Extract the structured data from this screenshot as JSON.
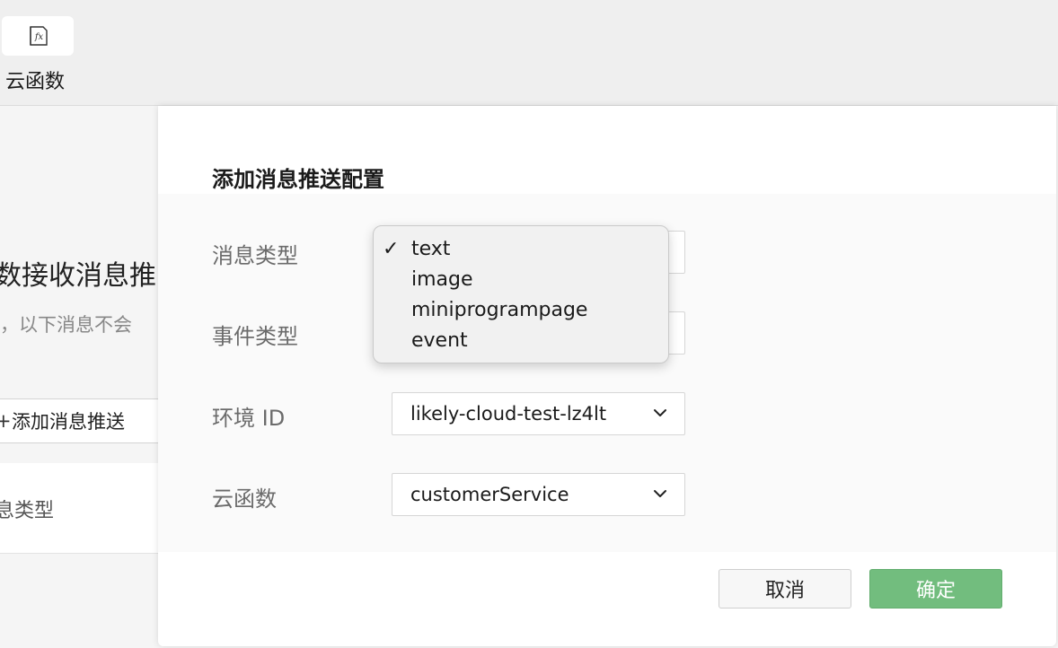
{
  "toolbar": {
    "cloud_function_label": "云函数",
    "cloud_function_icon": "fx-icon"
  },
  "background": {
    "heading": "数接收消息推",
    "subtext": "，以下消息不会",
    "add_button_label": "添加消息推送",
    "table_column": "息类型"
  },
  "dialog": {
    "title": "添加消息推送配置",
    "fields": {
      "message_type_label": "消息类型",
      "event_type_label": "事件类型",
      "env_id_label": "环境 ID",
      "env_id_value": "likely-cloud-test-lz4lt",
      "cloud_function_label": "云函数",
      "cloud_function_value": "customerService"
    },
    "cancel_label": "取消",
    "confirm_label": "确定"
  },
  "dropdown": {
    "check_mark": "✓",
    "options": [
      "text",
      "image",
      "miniprogrampage",
      "event"
    ],
    "selected": "text"
  },
  "colors": {
    "confirm_button": "#72bd7e",
    "label_gray": "#6b6b6b"
  }
}
